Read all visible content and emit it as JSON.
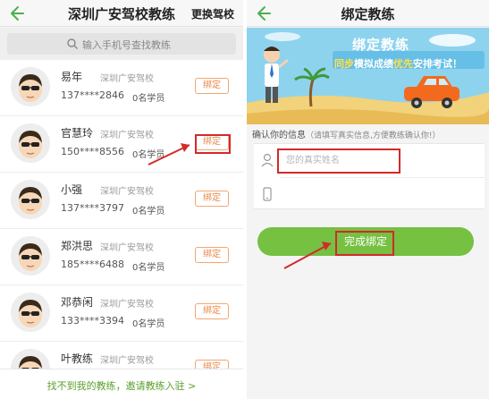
{
  "left": {
    "title": "深圳广安驾校教练",
    "switch_school": "更换驾校",
    "search": {
      "placeholder": "输入手机号查找教练"
    },
    "coaches": [
      {
        "name": "易年",
        "school": "深圳广安驾校",
        "phone": "137****2846",
        "students": "0名学员",
        "button": "绑定"
      },
      {
        "name": "官慧玲",
        "school": "深圳广安驾校",
        "phone": "150****8556",
        "students": "0名学员",
        "button": "绑定"
      },
      {
        "name": "小强",
        "school": "深圳广安驾校",
        "phone": "137****3797",
        "students": "0名学员",
        "button": "绑定"
      },
      {
        "name": "郑洪思",
        "school": "深圳广安驾校",
        "phone": "185****6488",
        "students": "0名学员",
        "button": "绑定"
      },
      {
        "name": "邓恭闲",
        "school": "深圳广安驾校",
        "phone": "133****3394",
        "students": "0名学员",
        "button": "绑定"
      },
      {
        "name": "叶教练",
        "school": "深圳广安驾校",
        "phone": "",
        "students": "",
        "button": "绑定"
      }
    ],
    "footer_link": "找不到我的教练，邀请教练入驻 >"
  },
  "right": {
    "title": "绑定教练",
    "banner": {
      "title": "绑定教练",
      "sub_part1": "同步",
      "sub_part2": "模拟成绩",
      "sub_part3": "优先",
      "sub_part4": "安排考试！"
    },
    "info_label": "确认你的信息",
    "info_hint": "（请填写真实信息,方便教练确认你!）",
    "name_field": {
      "placeholder": "您的真实姓名",
      "value": ""
    },
    "phone_field": {
      "placeholder": "",
      "value": ""
    },
    "submit": "完成绑定"
  },
  "colors": {
    "accent_green": "#76c042",
    "bind_orange": "#e8874a",
    "annotation_red": "#d22a2a"
  }
}
